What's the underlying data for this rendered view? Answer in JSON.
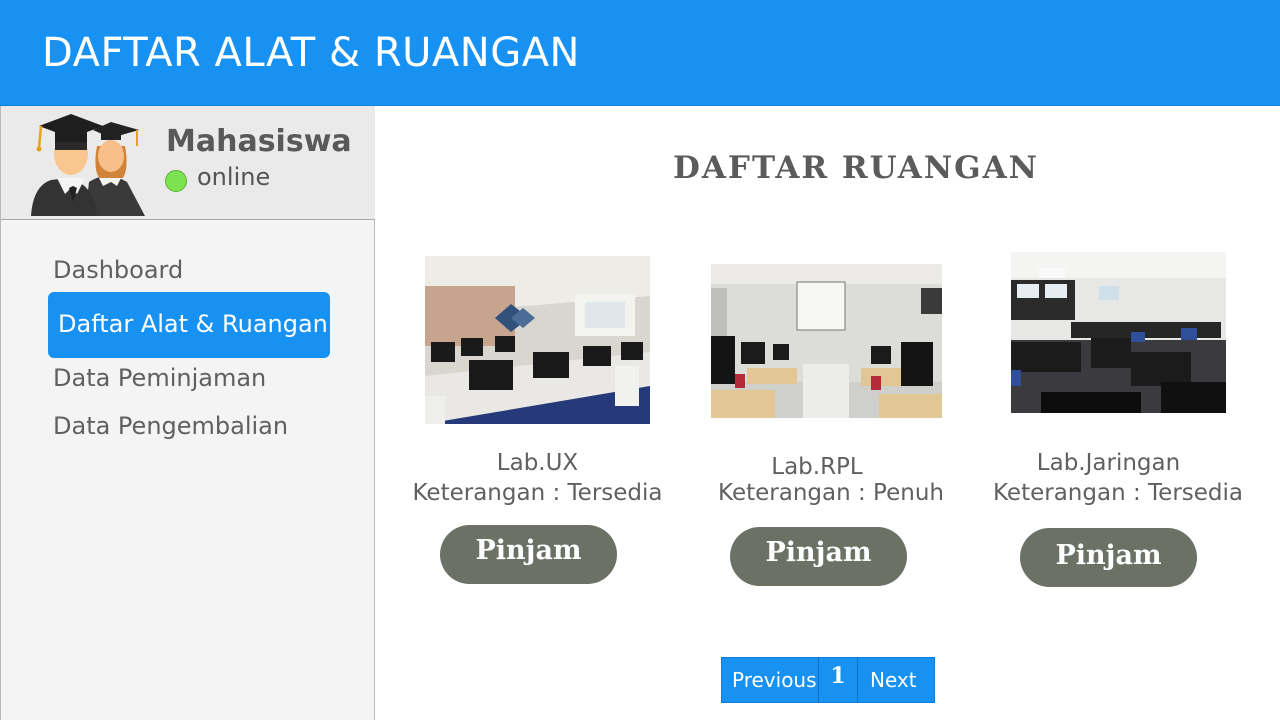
{
  "header": {
    "title": "DAFTAR ALAT & RUANGAN"
  },
  "profile": {
    "role": "Mahasiswa",
    "status": "online",
    "status_color": "#7de24f",
    "avatar_icon": "graduates-icon"
  },
  "nav": {
    "items": [
      {
        "label": "Dashboard",
        "active": false
      },
      {
        "label": "Daftar Alat & Ruangan",
        "active": true
      },
      {
        "label": "Data Peminjaman",
        "active": false
      },
      {
        "label": "Data Pengembalian",
        "active": false
      }
    ]
  },
  "main": {
    "title": "DAFTAR  RUANGAN",
    "rooms": [
      {
        "name": "Lab.UX",
        "info": "Keterangan : Tersedia",
        "button": "Pinjam"
      },
      {
        "name": "Lab.RPL",
        "info": "Keterangan : Penuh",
        "button": "Pinjam"
      },
      {
        "name": "Lab.Jaringan",
        "info": "Keterangan : Tersedia",
        "button": "Pinjam"
      }
    ]
  },
  "pagination": {
    "previous": "Previous",
    "current": "1",
    "next": "Next"
  },
  "colors": {
    "accent": "#1791f2",
    "button": "#6c7165",
    "sidebar_bg": "#f4f4f4"
  }
}
